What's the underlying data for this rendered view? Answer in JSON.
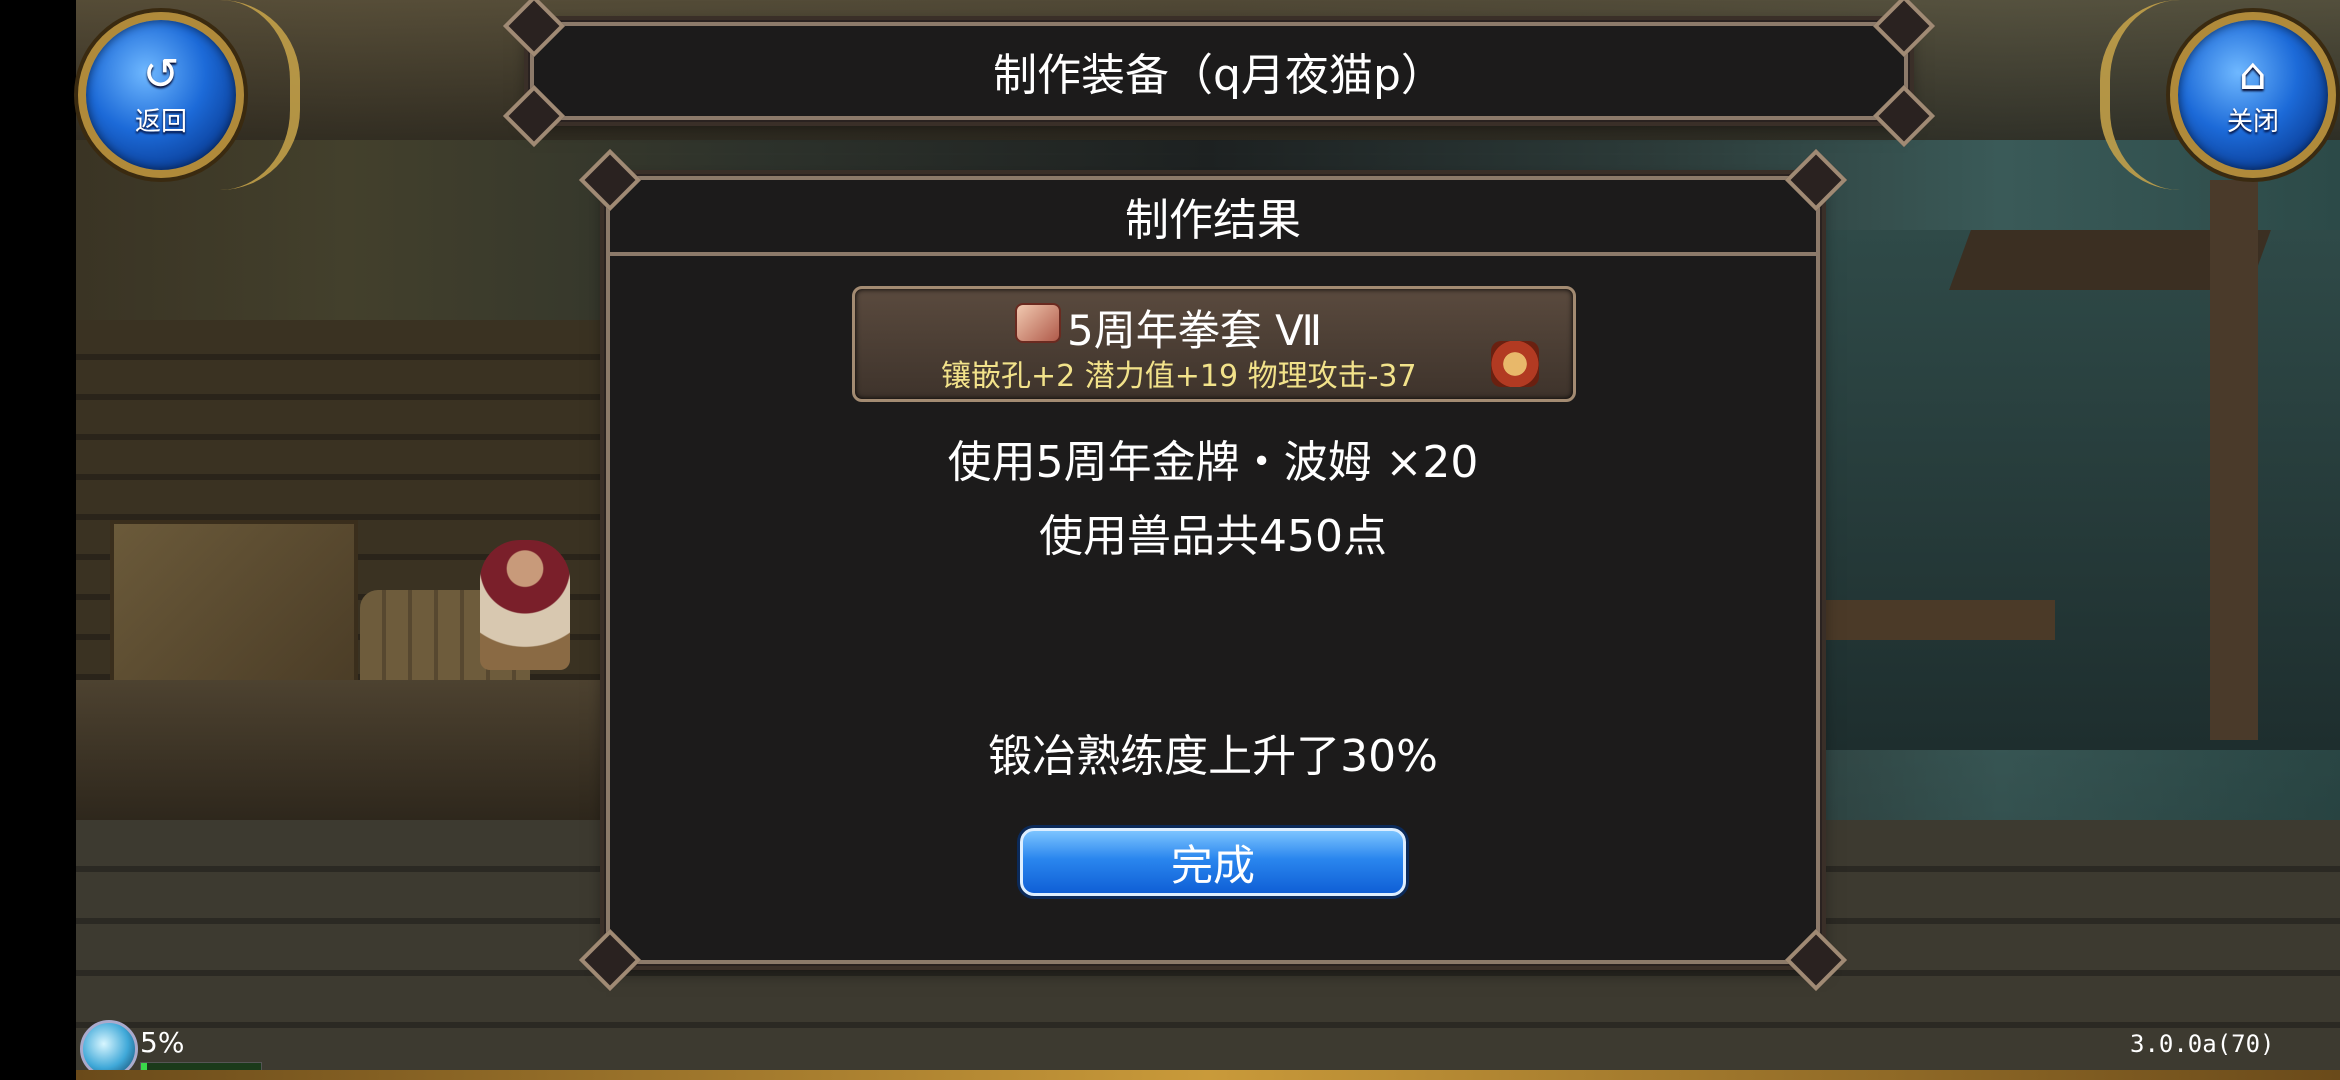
{
  "header": {
    "back_label": "返回",
    "close_label": "关闭",
    "title": "制作装备（q月夜猫p）"
  },
  "result": {
    "title": "制作结果",
    "item": {
      "name": "5周年拳套 Ⅶ",
      "stats": "镶嵌孔+2 潜力值+19 物理攻击-37",
      "icon": "scroll-icon",
      "chest_icon": "treasure-chest-icon"
    },
    "material_line": "使用5周年金牌・波姆 ×20",
    "points_line": "使用兽品共450点",
    "proficiency_line": "锻冶熟练度上升了30%",
    "done_label": "完成"
  },
  "hud": {
    "percent": "5%",
    "progress": 0.05,
    "version": "3.0.0a(70)"
  },
  "colors": {
    "accent_blue": "#1c6ad8",
    "panel_bg": "#1c1b1b",
    "stat_yellow": "#f2e28a",
    "gold_border": "#b08a3a"
  }
}
